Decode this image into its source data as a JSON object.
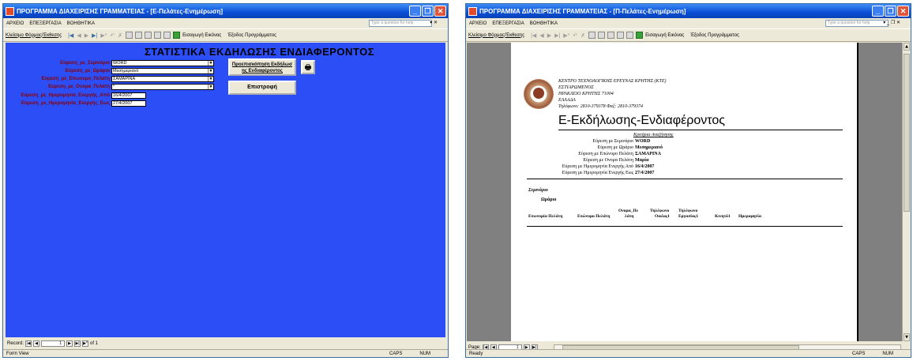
{
  "left": {
    "title": "ΠΡΟΓΡΑΜΜΑ ΔΙΑΧΕΙΡΙΣΗΣ ΓΡΑΜΜΑΤΕΙΑΣ - [Ε-Πελάτες-Ενημέρωση]",
    "menu": [
      "ΑΡΧΕΙΟ",
      "ΕΠΕΞΕΡΓΑΣΙΑ",
      "ΒΟΗΘΗΤΙΚΑ"
    ],
    "ask_placeholder": "Type a question for help",
    "toolbar": {
      "close_form": "Κλείσιμο Φόρμας/Έκθεσης",
      "import_image": "Εισαγωγή Εικόνας",
      "exit_program": "Έξοδος Προγράμματος"
    },
    "form": {
      "heading": "ΣΤΑΤΙΣΤΙΚΑ ΕΚΔΗΛΩΣΗΣ ΕΝΔΙΑΦΕΡΟΝΤΟΣ",
      "fields": [
        {
          "label": "Εύρεση_με_Σεμινάριο",
          "value": "WORD"
        },
        {
          "label": "Εύρεση_με_Ωράριο",
          "value": "Μεσημεριανό"
        },
        {
          "label": "Εύρεση_με_Επώνυμο_Πελάτη",
          "value": "ΣΑΜΑΡΙΝΑ"
        },
        {
          "label": "Εύρεση_με_Ονομα_Πελάτη",
          "value": "*"
        }
      ],
      "date_from_label": "Εύρεση_με_Ημερομηνία_Ενεργής_Από",
      "date_from": "16/4/2007",
      "date_to_label": "Εύρεση_με_Ημερομηνία_Ενεργής_Εως",
      "date_to": "27/4/2007",
      "preview_button": "Προεπισκόπηση Εκδήλωσ ης Ενδιαφέροντος",
      "return_button": "Επιστροφή"
    },
    "record_label": "Record:",
    "record_value": "1",
    "record_total": "of 1",
    "status_text": "Form View",
    "caps": "CAPS",
    "num": "NUM"
  },
  "right": {
    "title": "ΠΡΟΓΡΑΜΜΑ ΔΙΑΧΕΙΡΙΣΗΣ ΓΡΑΜΜΑΤΕΙΑΣ - [Π-Πελάτες-Ενημέρωση]",
    "menu": [
      "ΑΡΧΕΙΟ",
      "ΕΠΕΞΕΡΓΑΣΙΑ",
      "ΒΟΗΘΗΤΙΚΑ"
    ],
    "ask_placeholder": "Type a question for help",
    "toolbar": {
      "close_form": "Κλείσιμο Φόρμας/Έκθεσης",
      "import_image": "Εισαγωγή Εικόνας",
      "exit_program": "Έξοδος Προγράμματος"
    },
    "report": {
      "org_lines": [
        "ΚΕΝΤΡΟ ΤΕΧΝΟΛΟΓΙΚΗΣ ΕΡΕΥΝΑΣ ΚΡΗΤΗΣ (ΚΤΕ)",
        "ΕΣΤΙΑΡΩΜΕΝΟΣ",
        "ΗΡΑΚΛΕΙΟ ΚΡΗΤΗΣ   71004",
        "ΕΛΛΑΔΑ",
        "Τηλέφωνο: 2810-379378  Φαξ: 2810-379374"
      ],
      "title": "Ε-Εκδήλωσης-Ενδιαφέροντος",
      "criteria_heading": "Κριτήρια Αναζήτησης",
      "criteria": [
        {
          "k": "Εύρεση με Σεμινάριο",
          "v": "WORD"
        },
        {
          "k": "Εύρεση με Ωράριο",
          "v": "Μεσημεριανό"
        },
        {
          "k": "Εύρεση με Επώνυμο Πελάτη",
          "v": "ΣΑΜΑΡΙΝΑ"
        },
        {
          "k": "Εύρεση με Ονομα Πελάτη",
          "v": "Μαρία"
        },
        {
          "k": "Εύρεση με Ημερομηνία Ενεργής Από",
          "v": "16/4/2007"
        },
        {
          "k": "Εύρεση με Ημερομηνία Ενεργής Εως",
          "v": "27/4/2007"
        }
      ],
      "group1": "Σεμινάριο",
      "group2": "Ωράριο",
      "columns": {
        "c1": "Επωνυμία Πελάτη",
        "c2": "Επώνυμο Πελάτη",
        "c3a": "Ονομα_Πε",
        "c3b": "λάτη",
        "c4a": "Τηλέφωνο",
        "c4b": "Οικίας1",
        "c5a": "Τηλέφωνο",
        "c5b": "Εργασίας1",
        "c6": "Κινητό1",
        "c7": "Ημερομηνία"
      }
    },
    "page_label": "Page:",
    "page_value": "1",
    "status_text": "Ready",
    "caps": "CAPS",
    "num": "NUM"
  }
}
